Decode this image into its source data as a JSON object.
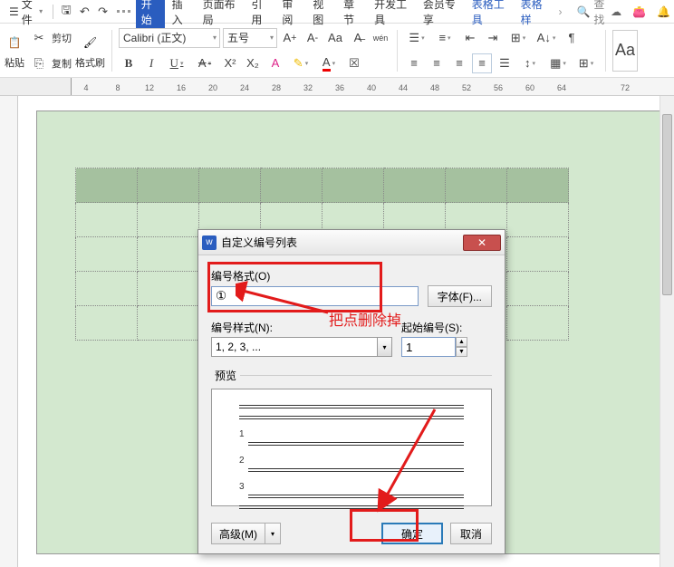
{
  "menubar": {
    "file": "文件",
    "tabs": [
      "开始",
      "插入",
      "页面布局",
      "引用",
      "审阅",
      "视图",
      "章节",
      "开发工具",
      "会员专享"
    ],
    "tool_tabs": [
      "表格工具",
      "表格样"
    ],
    "search": "查找"
  },
  "ribbon": {
    "paste": "粘贴",
    "cut": "剪切",
    "copy": "复制",
    "format_painter": "格式刷",
    "font_name": "Calibri (正文)",
    "font_size": "五号"
  },
  "ruler": {
    "marks": [
      4,
      8,
      12,
      16,
      20,
      24,
      28,
      32,
      36,
      40,
      44,
      48,
      52,
      56,
      60,
      64,
      72
    ]
  },
  "dialog": {
    "title": "自定义编号列表",
    "format_label": "编号格式(O)",
    "format_value": "①",
    "font_btn": "字体(F)...",
    "style_label": "编号样式(N):",
    "style_value": "1, 2, 3, ...",
    "start_label": "起始编号(S):",
    "start_value": "1",
    "preview_label": "预览",
    "preview_nums": [
      "1",
      "2",
      "3"
    ],
    "advanced": "高级(M)",
    "ok": "确定",
    "cancel": "取消"
  },
  "annotation": {
    "text": "把点删除掉"
  }
}
